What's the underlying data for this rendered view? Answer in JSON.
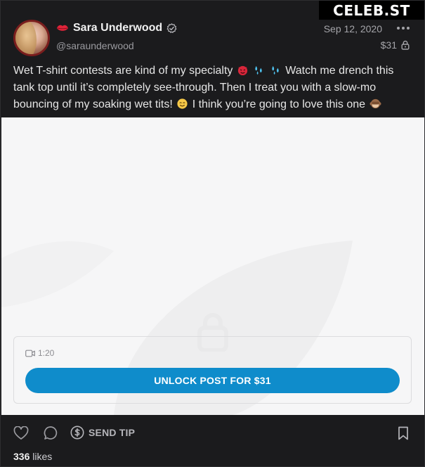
{
  "watermark": "CELEB.ST",
  "post": {
    "author": {
      "display_name": "Sara Underwood",
      "handle": "@saraunderwood",
      "name_badge_icon": "lips-icon",
      "verified_icon": "verified-icon"
    },
    "date": "Sep 12, 2020",
    "price": "$31",
    "caption": {
      "part1": "Wet T-shirt contests are kind of my specialty",
      "part2": "Watch me drench this tank top until it’s completely see-through. Then I treat you with a slow-mo bouncing of my soaking wet tits!",
      "part3": "I think you’re going to love this one"
    },
    "media": {
      "duration": "1:20",
      "unlock_label": "UNLOCK POST FOR $31"
    },
    "actions": {
      "send_tip_label": "SEND TIP"
    },
    "likes": {
      "count": "336",
      "label": "likes"
    }
  },
  "colors": {
    "background": "#1b1b1d",
    "accent": "#0f8ccb",
    "media_bg": "#f6f6f7"
  }
}
